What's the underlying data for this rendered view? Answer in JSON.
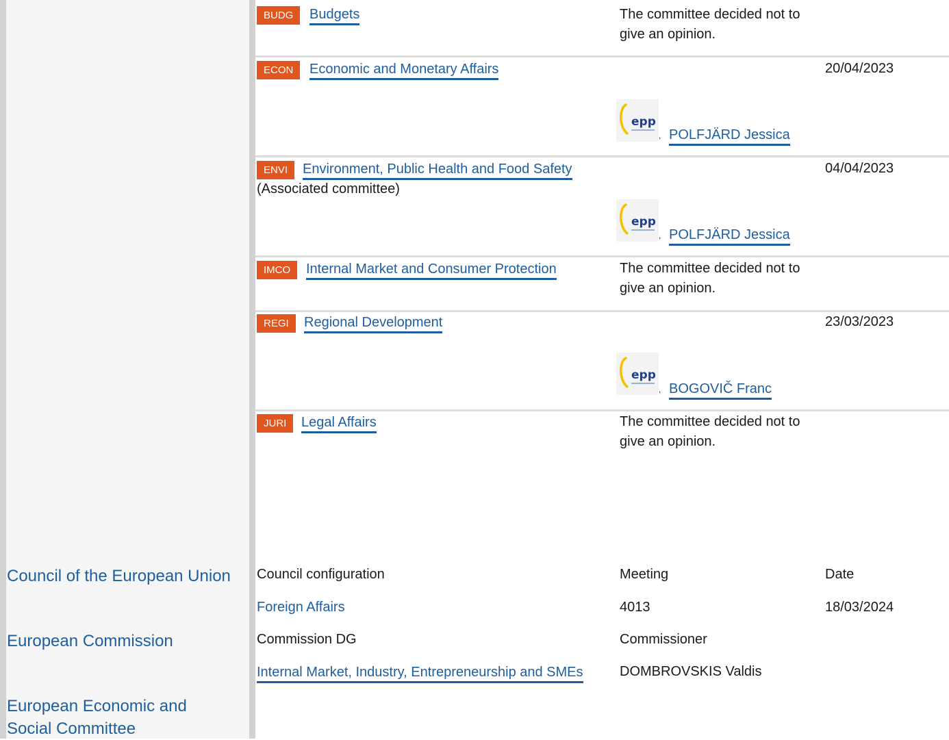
{
  "committees": [
    {
      "abbr": "BUDG",
      "name": "Budgets",
      "note": "",
      "opinion": "The committee decided not to give an opinion.",
      "date": "",
      "rapporteur": ""
    },
    {
      "abbr": "ECON",
      "name": "Economic and Monetary Affairs",
      "note": "",
      "opinion": "",
      "date": "20/04/2023",
      "rapporteur": "POLFJÄRD Jessica"
    },
    {
      "abbr": "ENVI",
      "name": "Environment, Public Health and Food Safety",
      "note": "(Associated committee)",
      "opinion": "",
      "date": "04/04/2023",
      "rapporteur": "POLFJÄRD Jessica"
    },
    {
      "abbr": "IMCO",
      "name": "Internal Market and Consumer Protection",
      "note": "",
      "opinion": "The committee decided not to give an opinion.",
      "date": "",
      "rapporteur": ""
    },
    {
      "abbr": "REGI",
      "name": "Regional Development",
      "note": "",
      "opinion": "",
      "date": "23/03/2023",
      "rapporteur": "BOGOVIČ Franc"
    },
    {
      "abbr": "JURI",
      "name": "Legal Affairs",
      "note": "",
      "opinion": "The committee decided not to give an opinion.",
      "date": "",
      "rapporteur": ""
    }
  ],
  "group_logo_text": "epp",
  "council": {
    "institution": "Council of the European Union",
    "headers": {
      "configuration": "Council configuration",
      "meeting": "Meeting",
      "date": "Date"
    },
    "row": {
      "configuration": "Foreign Affairs",
      "meeting": "4013",
      "date": "18/03/2024"
    }
  },
  "commission": {
    "institution": "European Commission",
    "headers": {
      "dg": "Commission DG",
      "commissioner": "Commissioner"
    },
    "row": {
      "dg": "Internal Market, Industry, Entrepreneurship and SMEs",
      "commissioner": "DOMBROVSKIS Valdis"
    }
  },
  "eesc": {
    "institution_line1": "European Economic and",
    "institution_line2": "Social Committee"
  }
}
